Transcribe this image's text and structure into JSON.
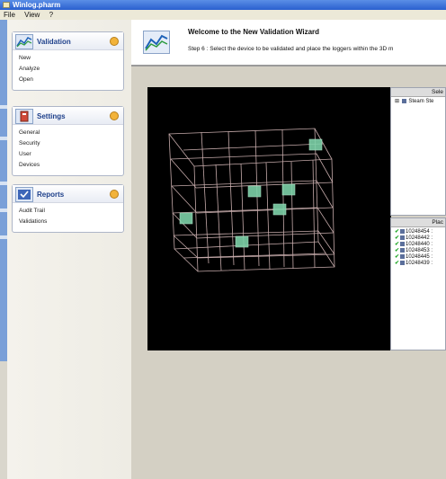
{
  "window": {
    "title": "Winlog.pharm"
  },
  "menu": {
    "items": [
      "File",
      "View",
      "?"
    ]
  },
  "sidebar": {
    "validation": {
      "title": "Validation",
      "items": [
        "New",
        "Analyze",
        "Open"
      ]
    },
    "settings": {
      "title": "Settings",
      "items": [
        "General",
        "Security",
        "User",
        "Devices"
      ]
    },
    "reports": {
      "title": "Reports",
      "items": [
        "Audit Trail",
        "Validations"
      ]
    }
  },
  "wizard": {
    "title": "Welcome to the New Validation Wizard",
    "step": "Step 6 : Select the device to be validated and place the loggers within the 3D m"
  },
  "select_panel": {
    "header": "Sele",
    "tree_item": "Steam Ste"
  },
  "place_panel": {
    "header": "Plac",
    "loggers": [
      "10248454 :",
      "10248442 :",
      "10248440 :",
      "10248453 :",
      "10248445 :",
      "10248439 :"
    ]
  },
  "colors": {
    "accent": "#2a5fcf",
    "check": "#1ea624",
    "logger_cube": "#7dd1a8"
  }
}
